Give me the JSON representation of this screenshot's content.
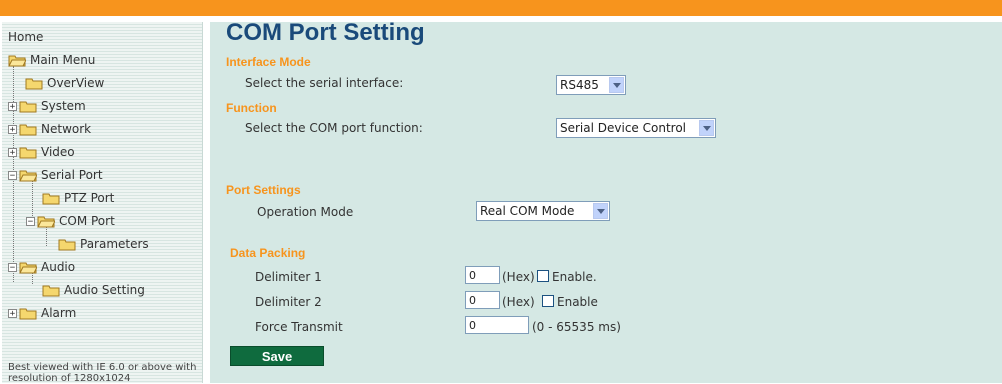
{
  "sidebar": {
    "home": "Home",
    "main_menu": "Main Menu",
    "items": {
      "overview": "OverView",
      "system": "System",
      "network": "Network",
      "video": "Video",
      "serial_port": "Serial Port",
      "ptz_port": "PTZ Port",
      "com_port": "COM Port",
      "parameters": "Parameters",
      "audio": "Audio",
      "audio_setting": "Audio Setting",
      "alarm": "Alarm"
    },
    "note": "Best viewed with IE 6.0 or above with resolution of 1280x1024"
  },
  "page": {
    "title": "COM Port Setting",
    "interface_mode": {
      "heading": "Interface Mode",
      "label": "Select the serial interface:",
      "value": "RS485"
    },
    "function": {
      "heading": "Function",
      "label": "Select the COM port function:",
      "value": "Serial Device Control"
    },
    "port_settings": {
      "heading": "Port Settings",
      "label": "Operation Mode",
      "value": "Real COM Mode"
    },
    "data_packing": {
      "heading": "Data Packing",
      "delimiter1": {
        "label": "Delimiter 1",
        "value": "0",
        "unit": "(Hex)",
        "check_label": "Enable."
      },
      "delimiter2": {
        "label": "Delimiter 2",
        "value": "0",
        "unit": "(Hex)",
        "check_label": "Enable"
      },
      "force_transmit": {
        "label": "Force Transmit",
        "value": "0",
        "unit": "(0 - 65535 ms)"
      }
    },
    "save_label": "Save"
  },
  "colors": {
    "accent": "#f7941d",
    "title": "#1a4a7a",
    "panel": "#d5e8e4",
    "save": "#0f6b3e"
  }
}
